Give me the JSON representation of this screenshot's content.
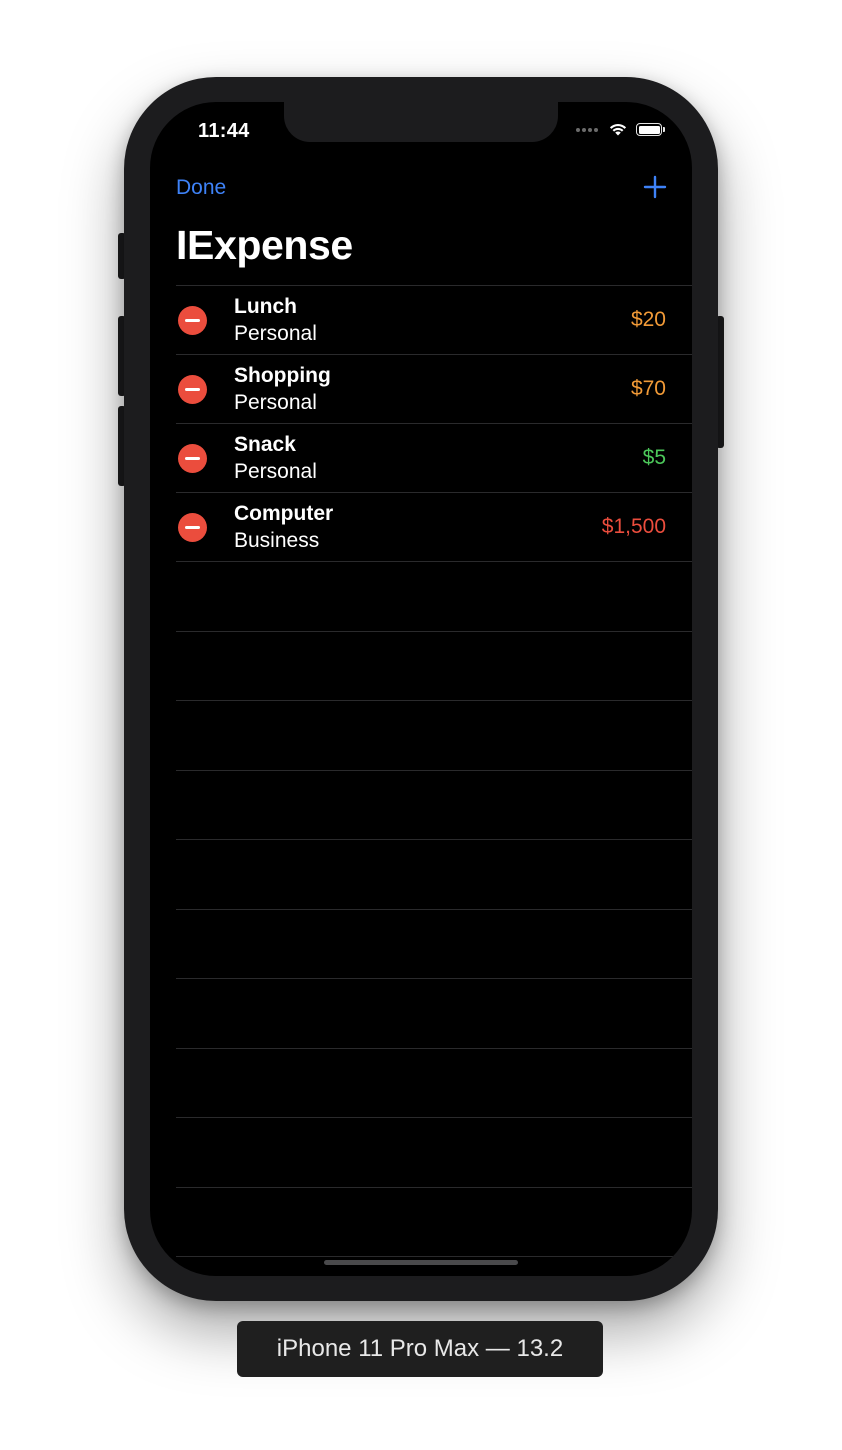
{
  "status_bar": {
    "time": "11:44"
  },
  "nav": {
    "edit_label": "Done",
    "add_icon": "plus-icon",
    "title": "IExpense"
  },
  "expenses": [
    {
      "name": "Lunch",
      "type": "Personal",
      "amount": "$20",
      "amount_color": "#f19a37"
    },
    {
      "name": "Shopping",
      "type": "Personal",
      "amount": "$70",
      "amount_color": "#f19a37"
    },
    {
      "name": "Snack",
      "type": "Personal",
      "amount": "$5",
      "amount_color": "#4cc85a"
    },
    {
      "name": "Computer",
      "type": "Business",
      "amount": "$1,500",
      "amount_color": "#eb4d3d"
    }
  ],
  "device_label": "iPhone 11 Pro Max — 13.2",
  "colors": {
    "accent": "#3e82f7",
    "delete": "#eb4d3d",
    "background": "#000000"
  }
}
